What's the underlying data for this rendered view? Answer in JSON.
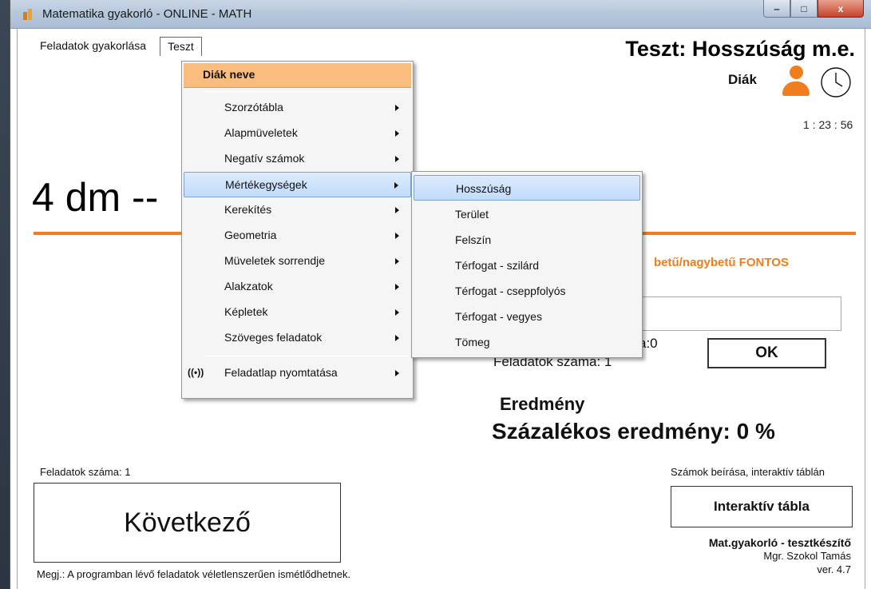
{
  "window": {
    "title": "Matematika gyakorló - ONLINE - MATH",
    "min": "‒",
    "max": "□",
    "close": "x"
  },
  "menubar": {
    "items": [
      "Feladatok gyakorlása",
      "Teszt"
    ]
  },
  "header": {
    "test_title": "Teszt: Hosszúság m.e.",
    "student_label": "Diák",
    "timer": "1 : 23 : 56"
  },
  "main": {
    "question": "4 dm --",
    "hint": "betű/nagybetű FONTOS",
    "answer_value": "",
    "good_count": "a:0",
    "task_count_mid": "Feladatok száma: 1",
    "ok_label": "OK",
    "result_label": "Eredmény",
    "percent_label": "Százalékos eredmény:  0 %"
  },
  "footer": {
    "task_count": "Feladatok száma: 1",
    "next_label": "Következő",
    "note": "Megj.: A programban lévő feladatok véletlenszerűen ismétlődhetnek.",
    "iboard_caption": "Számok beírása, interaktív táblán",
    "iboard_label": "Interaktív tábla",
    "credit_title": "Mat.gyakorló - tesztkészítő",
    "credit_author": "Mgr. Szokol Tamás",
    "credit_version": "ver. 4.7"
  },
  "dropdown": {
    "header": "Diák neve",
    "items": [
      {
        "label": "Szorzótábla"
      },
      {
        "label": "Alapmüveletek"
      },
      {
        "label": "Negatív számok"
      },
      {
        "label": "Mértékegységek"
      },
      {
        "label": "Kerekítés"
      },
      {
        "label": "Geometria"
      },
      {
        "label": "Müveletek sorrendje"
      },
      {
        "label": "Alakzatok"
      },
      {
        "label": "Képletek"
      },
      {
        "label": "Szöveges feladatok"
      }
    ],
    "print_icon": "((•))",
    "print_label": "Feladatlap nyomtatása"
  },
  "submenu": {
    "items": [
      {
        "label": "Hosszúság"
      },
      {
        "label": "Terület"
      },
      {
        "label": "Felszín"
      },
      {
        "label": "Térfogat - szilárd"
      },
      {
        "label": "Térfogat - cseppfolyós"
      },
      {
        "label": "Térfogat - vegyes"
      },
      {
        "label": "Tömeg"
      }
    ]
  },
  "colors": {
    "accent": "#f07d1e",
    "menu_header": "#fbbd7e",
    "highlight": "#c1dbfc"
  },
  "icons": {
    "student": "user-icon",
    "clock": "clock-icon",
    "print": "broadcast-icon",
    "submenu": "chevron-right-icon"
  }
}
